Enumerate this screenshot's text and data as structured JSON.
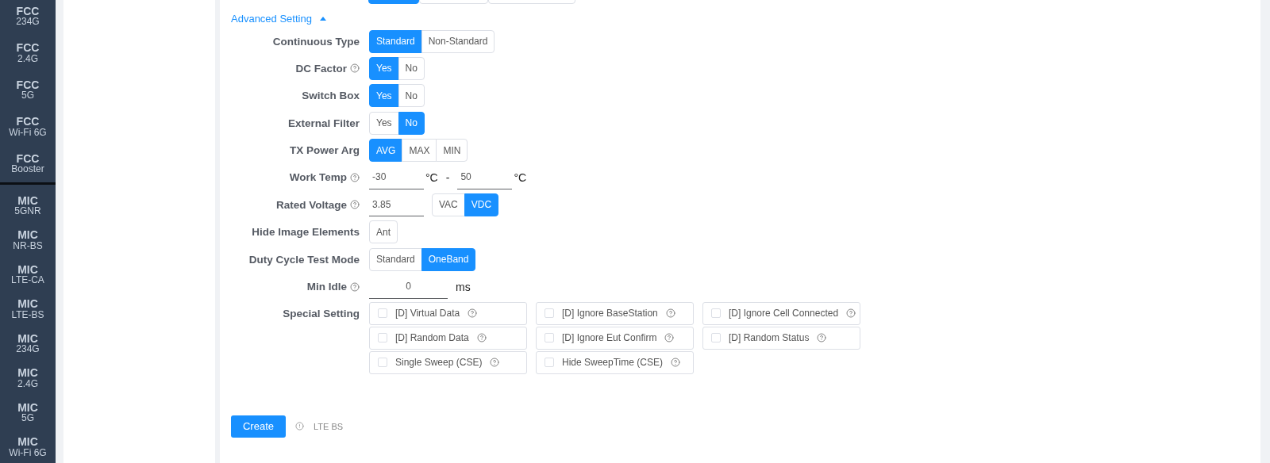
{
  "sidebar": {
    "groups": [
      {
        "items": [
          {
            "title": "FCC",
            "subtitle": "234G"
          },
          {
            "title": "FCC",
            "subtitle": "2.4G"
          },
          {
            "title": "FCC",
            "subtitle": "5G"
          },
          {
            "title": "FCC",
            "subtitle": "Wi-Fi 6G"
          },
          {
            "title": "FCC",
            "subtitle": "Booster"
          }
        ]
      },
      {
        "items": [
          {
            "title": "MIC",
            "subtitle": "5GNR"
          },
          {
            "title": "MIC",
            "subtitle": "NR-BS"
          },
          {
            "title": "MIC",
            "subtitle": "LTE-CA"
          },
          {
            "title": "MIC",
            "subtitle": "LTE-BS"
          },
          {
            "title": "MIC",
            "subtitle": "234G"
          },
          {
            "title": "MIC",
            "subtitle": "2.4G"
          },
          {
            "title": "MIC",
            "subtitle": "5G"
          },
          {
            "title": "MIC",
            "subtitle": "Wi-Fi 6G"
          }
        ]
      }
    ]
  },
  "top_options": [
    {
      "selected": true
    },
    {
      "selected": false
    },
    {
      "selected": false
    }
  ],
  "advanced": {
    "label": "Advanced Setting",
    "expanded": true
  },
  "rows": [
    {
      "kind": "segmented",
      "label": "Continuous Type",
      "help": false,
      "options": [
        {
          "label": "Standard",
          "selected": true
        },
        {
          "label": "Non-Standard",
          "selected": false
        }
      ]
    },
    {
      "kind": "segmented",
      "label": "DC Factor",
      "help": true,
      "options": [
        {
          "label": "Yes",
          "selected": true
        },
        {
          "label": "No",
          "selected": false
        }
      ]
    },
    {
      "kind": "segmented",
      "label": "Switch Box",
      "help": false,
      "options": [
        {
          "label": "Yes",
          "selected": true
        },
        {
          "label": "No",
          "selected": false
        }
      ]
    },
    {
      "kind": "segmented",
      "label": "External Filter",
      "help": false,
      "options": [
        {
          "label": "Yes",
          "selected": false
        },
        {
          "label": "No",
          "selected": true
        }
      ]
    },
    {
      "kind": "segmented",
      "label": "TX Power Arg",
      "help": false,
      "options": [
        {
          "label": "AVG",
          "selected": true
        },
        {
          "label": "MAX",
          "selected": false
        },
        {
          "label": "MIN",
          "selected": false
        }
      ]
    },
    {
      "kind": "range",
      "label": "Work Temp",
      "help": true,
      "from": "-30",
      "from_unit": "°C",
      "separator": "-",
      "to": "50",
      "to_unit": "°C"
    },
    {
      "kind": "input_segmented",
      "label": "Rated Voltage",
      "help": true,
      "value": "3.85",
      "options": [
        {
          "label": "VAC",
          "selected": false
        },
        {
          "label": "VDC",
          "selected": true
        }
      ]
    },
    {
      "kind": "segmented",
      "label": "Hide Image Elements",
      "help": false,
      "options": [
        {
          "label": "Ant",
          "selected": false
        }
      ]
    },
    {
      "kind": "segmented",
      "label": "Duty Cycle Test Mode",
      "help": false,
      "options": [
        {
          "label": "Standard",
          "selected": false
        },
        {
          "label": "OneBand",
          "selected": true
        }
      ]
    },
    {
      "kind": "input",
      "label": "Min Idle",
      "help": true,
      "value": "0",
      "unit": "ms"
    },
    {
      "kind": "checkboxes",
      "label": "Special Setting",
      "help": false,
      "items": [
        {
          "label": "[D] Virtual Data",
          "checked": false,
          "help": true
        },
        {
          "label": "[D] Ignore BaseStation",
          "checked": false,
          "help": true
        },
        {
          "label": "[D] Ignore Cell Connected",
          "checked": false,
          "help": true
        },
        {
          "label": "[D] Random Data",
          "checked": false,
          "help": true
        },
        {
          "label": "[D] Ignore Eut Confirm",
          "checked": false,
          "help": true
        },
        {
          "label": "[D] Random Status",
          "checked": false,
          "help": true
        },
        {
          "label": "Single Sweep (CSE)",
          "checked": false,
          "help": true
        },
        {
          "label": "Hide SweepTime (CSE)",
          "checked": false,
          "help": true
        }
      ]
    }
  ],
  "footer": {
    "button": "Create",
    "note": "LTE BS"
  }
}
